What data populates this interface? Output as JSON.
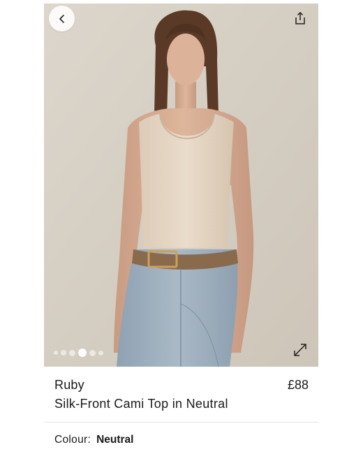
{
  "product": {
    "brand": "Ruby",
    "price": "£88",
    "name": "Silk-Front Cami Top in Neutral",
    "colour_label": "Colour:",
    "colour_value": "Neutral"
  },
  "gallery": {
    "image_count": 6,
    "active_index": 4
  },
  "icons": {
    "back": "chevron-left-icon",
    "share": "share-icon",
    "expand": "expand-icon"
  },
  "colors": {
    "background": "#ffffff",
    "text": "#1a1a1a",
    "divider": "#e5e5e5"
  }
}
